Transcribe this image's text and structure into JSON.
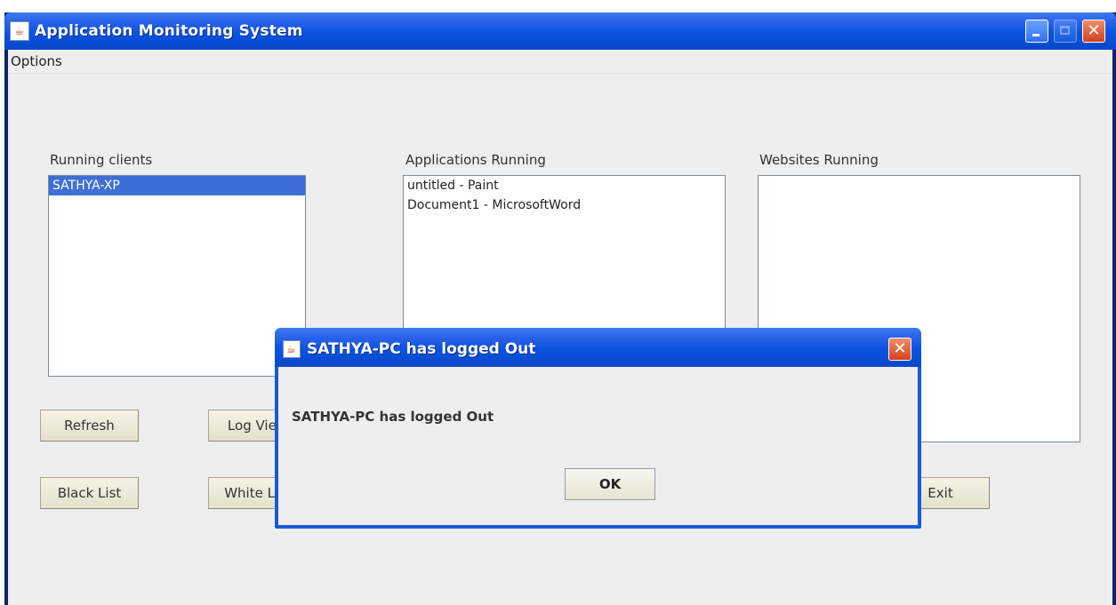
{
  "window": {
    "title": "Application Monitoring System",
    "icon": "java-cup-icon"
  },
  "menu": {
    "options": "Options"
  },
  "panels": {
    "clients": {
      "label": "Running clients",
      "items": [
        "SATHYA-XP"
      ],
      "selected_index": 0
    },
    "applications": {
      "label": "Applications Running",
      "items": [
        "untitled - Paint",
        "Document1 - MicrosoftWord"
      ]
    },
    "websites": {
      "label": "Websites Running",
      "items": []
    }
  },
  "buttons": {
    "refresh": "Refresh",
    "log_view": "Log View",
    "black_list": "Black List",
    "white_list": "White List",
    "exit": "Exit"
  },
  "dialog": {
    "title": "SATHYA-PC has logged Out",
    "message": "SATHYA-PC has logged Out",
    "ok_label": "OK"
  },
  "colors": {
    "title_bar": "#0a53e0",
    "selection": "#3e6fd6",
    "client_bg": "#eeeeee"
  }
}
